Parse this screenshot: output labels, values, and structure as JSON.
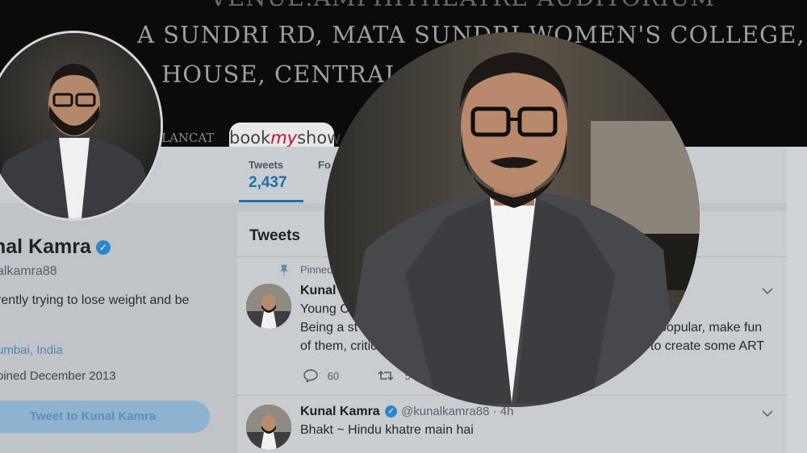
{
  "banner": {
    "line1": "VENUE:AMPHITHEATRE AUDITORIUM",
    "line2": "A SUNDRI RD, MATA SUNDRI WOMEN'S COLLEGE,",
    "line3": "HOUSE, CENTRAL DEL",
    "small_text": "LANCAT",
    "bms_prefix": "book",
    "bms_mid": "my",
    "bms_suffix": "show"
  },
  "stats": {
    "tweets_label": "Tweets",
    "tweets_value": "2,437",
    "following_label": "Fo"
  },
  "profile": {
    "name": "nal Kamra",
    "verified_glyph": "✓",
    "handle": "alkamra88",
    "bio_line1": "rently trying to lose weight and be",
    "bio_line2": ".",
    "location": "umbai, India",
    "joined": "oined December 2013",
    "tweet_to_button": "Tweet to Kunal Kamra"
  },
  "timeline": {
    "title": "Tweets",
    "pinned_label": "Pinned",
    "tweets": [
      {
        "name": "Kunal",
        "line1": "Young C",
        "line2_left": "Being a st",
        "line2_right": "popular, make fun",
        "line3_left": "of them, critic",
        "line3_right": "to create some ART",
        "reply_count": "60",
        "retweet_count": "5"
      },
      {
        "name": "Kunal Kamra",
        "handle": "@kunalkamra88 · 4h",
        "text": "Bhakt ~ Hindu khatre main hai"
      }
    ]
  },
  "colors": {
    "accent": "#1f6fa8",
    "verified": "#2e86c8",
    "banner_bg": "#0b0b0b"
  },
  "icons": {
    "pin": "pin-icon",
    "reply": "reply-icon",
    "retweet": "retweet-icon",
    "chevron": "chevron-down-icon",
    "verified": "verified-badge-icon"
  }
}
